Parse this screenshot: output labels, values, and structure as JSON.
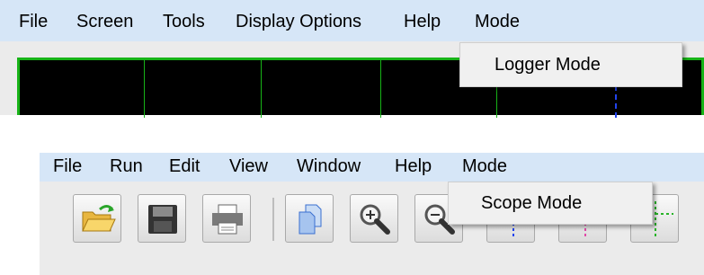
{
  "top": {
    "menu": [
      "File",
      "Screen",
      "Tools",
      "Display Options",
      "Help",
      "Mode"
    ],
    "dropdown_item": "Logger Mode"
  },
  "bottom": {
    "menu": [
      "File",
      "Run",
      "Edit",
      "View",
      "Window",
      "Help",
      "Mode"
    ],
    "dropdown_item": "Scope Mode",
    "toolbar_icons": [
      "open-folder-icon",
      "save-icon",
      "print-icon",
      "copy-pages-icon",
      "zoom-in-icon",
      "zoom-out-icon",
      "channel-view-1-icon",
      "channel-view-2-icon",
      "channel-view-3-icon"
    ]
  },
  "colors": {
    "menubar_bg": "#d6e6f7",
    "panel_bg": "#ebebeb",
    "screen_bg": "#000000",
    "grid_green": "#17b317",
    "marker_blue": "#2244ee",
    "marker_pink": "#e04aa8",
    "marker_green": "#28b428"
  }
}
